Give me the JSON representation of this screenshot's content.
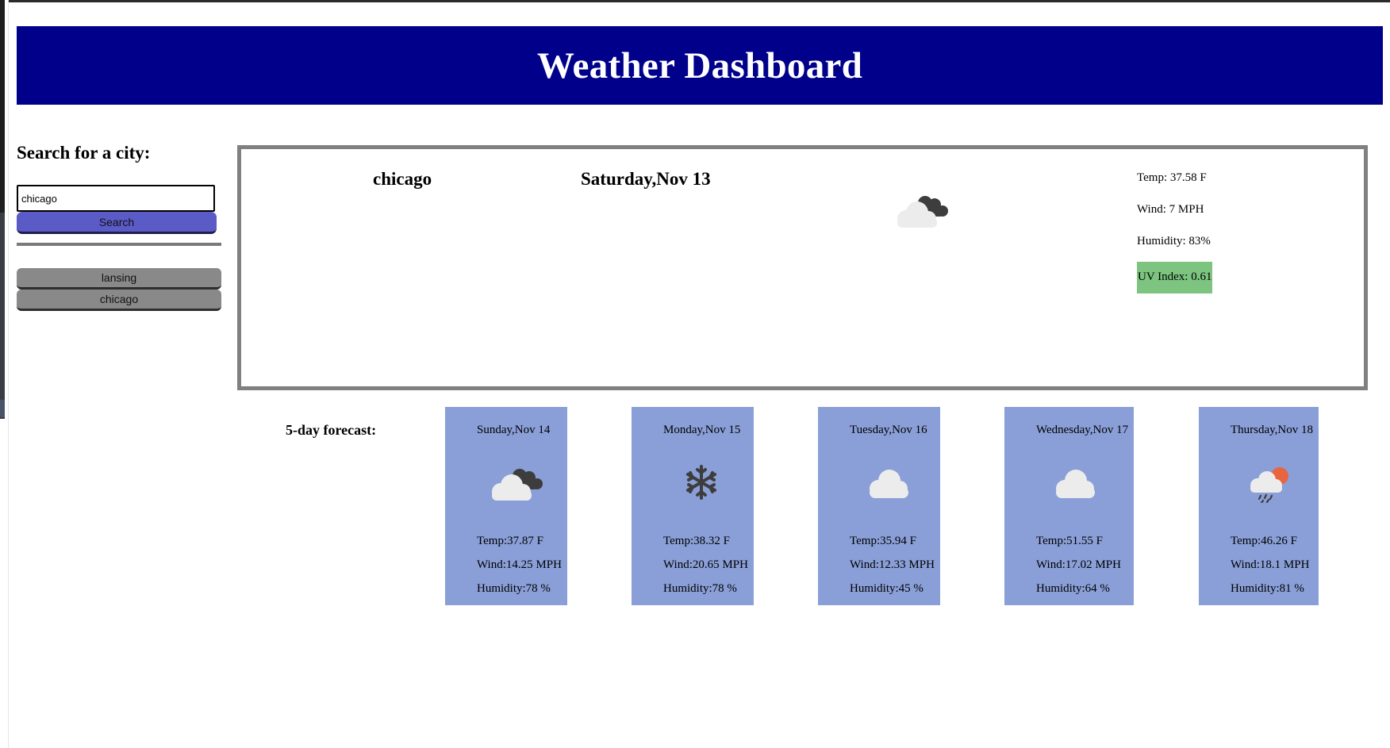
{
  "header": {
    "title": "Weather Dashboard"
  },
  "search": {
    "label": "Search for a city:",
    "input_value": "chicago",
    "button_label": "Search"
  },
  "history": [
    "lansing",
    "chicago"
  ],
  "current": {
    "city": "chicago",
    "date": "Saturday,Nov 13",
    "icon": "partly-cloudy-icon",
    "temp": "Temp: 37.58 F",
    "wind": "Wind: 7 MPH",
    "humidity": "Humidity: 83%",
    "uv": "UV Index: 0.61",
    "uv_color": "#7cc47f"
  },
  "forecast": {
    "label": "5-day forecast:",
    "card_color": "#8a9fd7",
    "days": [
      {
        "date": "Sunday,Nov 14",
        "icon": "partly-cloudy-icon",
        "temp": "Temp:37.87 F",
        "wind": "Wind:14.25 MPH",
        "humidity": "Humidity:78 %"
      },
      {
        "date": "Monday,Nov 15",
        "icon": "snowflake-icon",
        "temp": "Temp:38.32 F",
        "wind": "Wind:20.65 MPH",
        "humidity": "Humidity:78 %"
      },
      {
        "date": "Tuesday,Nov 16",
        "icon": "cloud-icon",
        "temp": "Temp:35.94 F",
        "wind": "Wind:12.33 MPH",
        "humidity": "Humidity:45 %"
      },
      {
        "date": "Wednesday,Nov 17",
        "icon": "cloud-icon",
        "temp": "Temp:51.55 F",
        "wind": "Wind:17.02 MPH",
        "humidity": "Humidity:64 %"
      },
      {
        "date": "Thursday,Nov 18",
        "icon": "sun-rain-icon",
        "temp": "Temp:46.26 F",
        "wind": "Wind:18.1 MPH",
        "humidity": "Humidity:81 %"
      }
    ]
  },
  "colors": {
    "header_bg": "#00008b",
    "search_button": "#5b5bc8",
    "history_button": "#898989"
  }
}
